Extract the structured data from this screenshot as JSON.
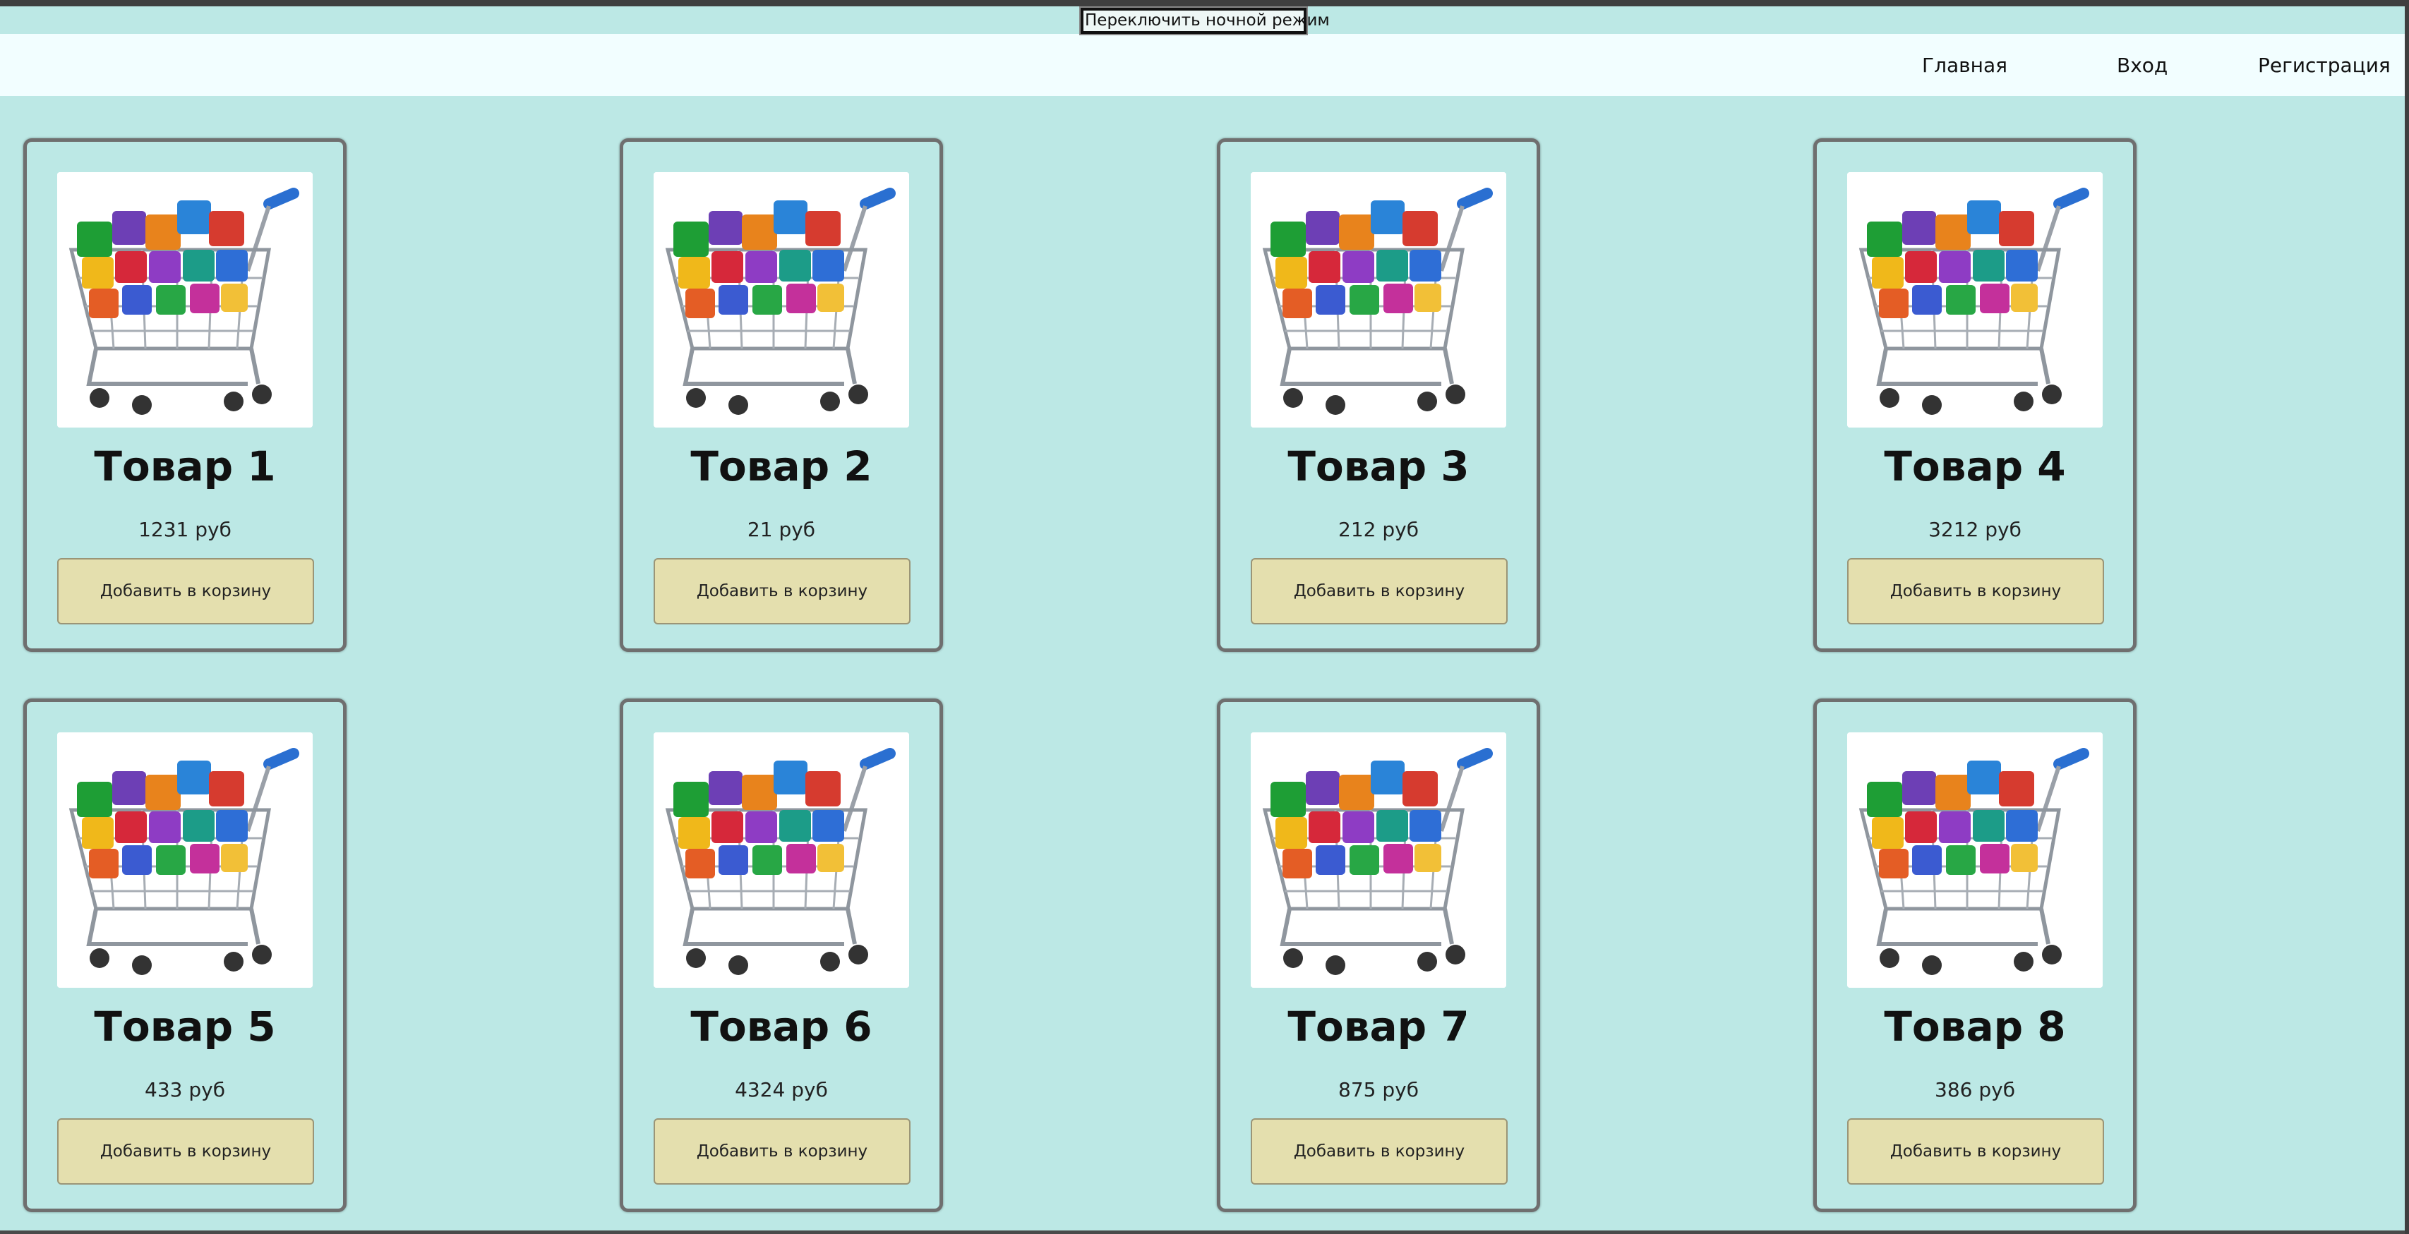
{
  "theme_toggle": {
    "label": "Переключить ночной режим"
  },
  "nav": {
    "items": [
      {
        "label": "Главная"
      },
      {
        "label": "Вход"
      },
      {
        "label": "Регистрация"
      }
    ]
  },
  "colors": {
    "page_background": "#bce8e5",
    "navbar_background": "#f2feff",
    "button_background": "#e4dfae",
    "card_border": "#6f6f6f"
  },
  "products": [
    {
      "title": "Товар 1",
      "price": "1231 руб",
      "button_label": "Добавить в корзину",
      "image_icon": "shopping-cart-with-app-cubes"
    },
    {
      "title": "Товар 2",
      "price": "21 руб",
      "button_label": "Добавить в корзину",
      "image_icon": "shopping-cart-with-app-cubes"
    },
    {
      "title": "Товар 3",
      "price": "212 руб",
      "button_label": "Добавить в корзину",
      "image_icon": "shopping-cart-with-app-cubes"
    },
    {
      "title": "Товар 4",
      "price": "3212 руб",
      "button_label": "Добавить в корзину",
      "image_icon": "shopping-cart-with-app-cubes"
    },
    {
      "title": "Товар 5",
      "price": "433 руб",
      "button_label": "Добавить в корзину",
      "image_icon": "shopping-cart-with-app-cubes"
    },
    {
      "title": "Товар 6",
      "price": "4324 руб",
      "button_label": "Добавить в корзину",
      "image_icon": "shopping-cart-with-app-cubes"
    },
    {
      "title": "Товар 7",
      "price": "875 руб",
      "button_label": "Добавить в корзину",
      "image_icon": "shopping-cart-with-app-cubes"
    },
    {
      "title": "Товар 8",
      "price": "386 руб",
      "button_label": "Добавить в корзину",
      "image_icon": "shopping-cart-with-app-cubes"
    }
  ]
}
